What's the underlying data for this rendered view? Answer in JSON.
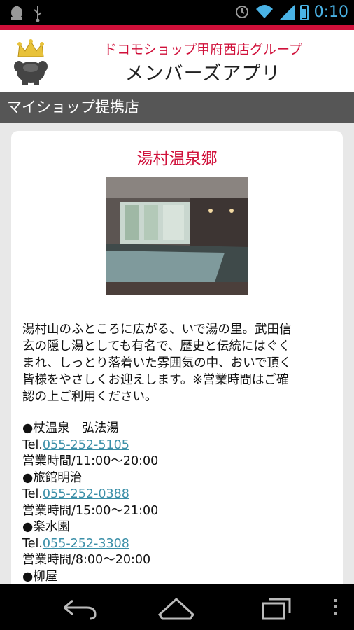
{
  "status_bar": {
    "time": "0:10",
    "icons": [
      "android-debug-icon",
      "usb-icon",
      "alarm-icon",
      "wifi-icon",
      "signal-icon",
      "battery-icon"
    ]
  },
  "header": {
    "subtitle": "ドコモショップ甲府西店グループ",
    "title": "メンバーズアプリ",
    "logo_icon": "crown-mascot-icon",
    "accent_color": "#d0103a"
  },
  "section": {
    "title": "マイショップ提携店"
  },
  "shop": {
    "name": "湯村温泉郷",
    "description": "湯村山のふところに広がる、いで湯の里。武田信玄の隠し湯としても有名で、歴史と伝統にはぐくまれ、しっとり落着いた雰囲気の中、おいで頂く皆様をやさしくお迎えします。※営業時間はご確認の上ご利用ください。",
    "description_lines": [
      "湯村山のふところに広がる、いで湯の里。武田信",
      "玄の隠し湯としても有名で、歴史と伝統にはぐく",
      "まれ、しっとり落着いた雰囲気の中、おいで頂く",
      "皆様をやさしくお迎えします。※営業時間はご確",
      "認の上ご利用ください。"
    ],
    "tel_prefix": "Tel.",
    "facilities": [
      {
        "name": "●杖温泉　弘法湯",
        "tel": "055-252-5105",
        "hours": "営業時間/11:00～20:00"
      },
      {
        "name": "●旅館明治",
        "tel": "055-252-0388",
        "hours": "営業時間/15:00～21:00"
      },
      {
        "name": "●楽水園",
        "tel": "055-252-3308",
        "hours": "営業時間/8:00～20:00"
      },
      {
        "name": "●柳屋"
      }
    ]
  },
  "nav_bar": {
    "buttons": [
      "back-icon",
      "home-icon",
      "recents-icon",
      "overflow-menu-icon"
    ]
  }
}
